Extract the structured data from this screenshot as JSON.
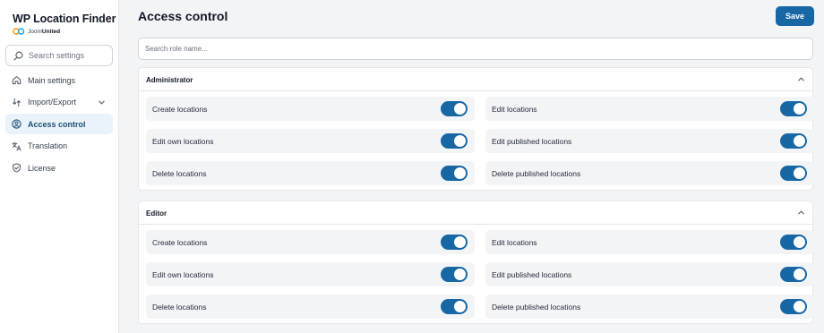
{
  "sidebar": {
    "logo_title": "WP Location Finder",
    "logo_sub_plain": "Joom",
    "logo_sub_bold": "United",
    "search_placeholder": "Search settings",
    "items": [
      {
        "label": "Main settings",
        "icon": "home-icon"
      },
      {
        "label": "Import/Export",
        "icon": "import-export-icon",
        "has_dropdown": true
      },
      {
        "label": "Access control",
        "icon": "user-circle-icon",
        "active": true
      },
      {
        "label": "Translation",
        "icon": "translate-icon"
      },
      {
        "label": "License",
        "icon": "shield-check-icon"
      }
    ]
  },
  "header": {
    "title": "Access control",
    "save_label": "Save"
  },
  "role_search": {
    "placeholder": "Search role name..."
  },
  "roles": [
    {
      "name": "Administrator",
      "permissions": [
        {
          "label": "Create locations",
          "enabled": true
        },
        {
          "label": "Edit locations",
          "enabled": true
        },
        {
          "label": "Edit own locations",
          "enabled": true
        },
        {
          "label": "Edit published locations",
          "enabled": true
        },
        {
          "label": "Delete locations",
          "enabled": true
        },
        {
          "label": "Delete published locations",
          "enabled": true
        }
      ]
    },
    {
      "name": "Editor",
      "permissions": [
        {
          "label": "Create locations",
          "enabled": true
        },
        {
          "label": "Edit locations",
          "enabled": true
        },
        {
          "label": "Edit own locations",
          "enabled": true
        },
        {
          "label": "Edit published locations",
          "enabled": true
        },
        {
          "label": "Delete locations",
          "enabled": true
        },
        {
          "label": "Delete published locations",
          "enabled": true
        }
      ]
    }
  ],
  "colors": {
    "accent": "#1767a5",
    "active_nav_bg": "#eaf3fb",
    "permission_bg": "#f3f4f6"
  }
}
